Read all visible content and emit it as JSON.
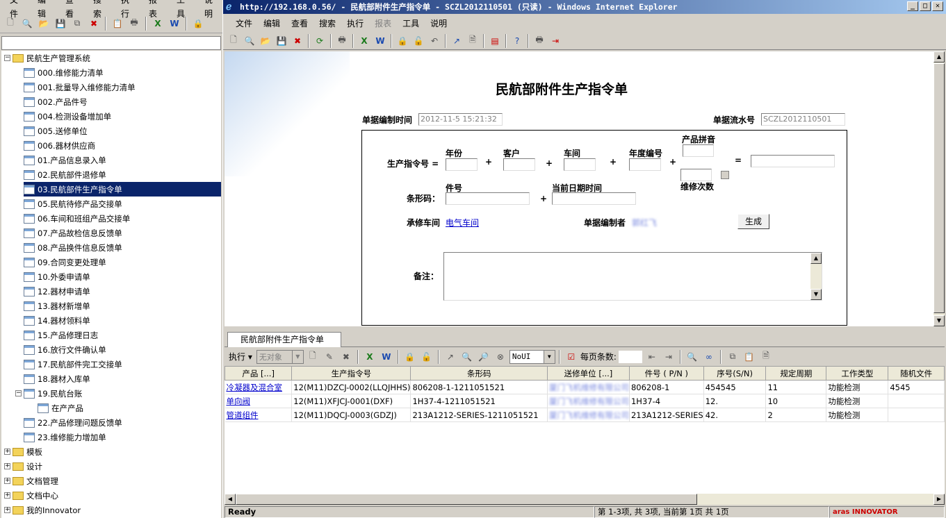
{
  "left_app": {
    "menu": [
      "文件",
      "编辑",
      "查看",
      "搜索",
      "执行",
      "报表",
      "工具",
      "说明"
    ],
    "tree": {
      "root": "民航生产管理系统",
      "items": [
        "000.维修能力清单",
        "001.批量导入维修能力清单",
        "002.产品件号",
        "004.检测设备增加单",
        "005.送修单位",
        "006.器材供应商",
        "01.产品信息录入单",
        "02.民航部件退修单",
        "03.民航部件生产指令单",
        "05.民航待修产品交接单",
        "06.车间和班组产品交接单",
        "07.产品故检信息反馈单",
        "08.产品换件信息反馈单",
        "09.合同变更处理单",
        "10.外委申请单",
        "12.器材申请单",
        "13.器材新增单",
        "14.器材领料单",
        "15.产品修理日志",
        "16.放行文件确认单",
        "17.民航部件完工交接单",
        "18.器材入库单",
        "19.民航台账",
        "在产产品",
        "22.产品修理问题反馈单",
        "23.维修能力增加单"
      ],
      "selected_index": 8,
      "other_roots": [
        "模板",
        "设计",
        "文档管理",
        "文档中心",
        "我的Innovator"
      ]
    }
  },
  "ie": {
    "title": "http://192.168.0.56/ - 民航部附件生产指令单 - SCZL2012110501 (只读) - Windows Internet Explorer",
    "menu": [
      "文件",
      "编辑",
      "查看",
      "搜索",
      "执行",
      "报表",
      "工具",
      "说明"
    ],
    "form": {
      "heading": "民航部附件生产指令单",
      "created_time_label": "单据编制时间",
      "created_time_value": "2012-11-5 15:21:32",
      "serial_label": "单据流水号",
      "serial_value": "SCZL2012110501",
      "order_no_label": "生产指令号 =",
      "year_label": "年份",
      "customer_label": "客户",
      "workshop_label": "车间",
      "annual_no_label": "年度编号",
      "product_pinyin_label": "产品拼音",
      "repair_count_label": "维修次数",
      "plus": "+",
      "equals": "=",
      "barcode_label": "条形码：",
      "part_no_label": "件号",
      "current_date_label": "当前日期时间",
      "repair_workshop_label": "承修车间",
      "repair_workshop_value": "电气车间",
      "author_label": "单据编制者",
      "author_value": "郭红飞",
      "generate_button": "生成",
      "remarks_label": "备注："
    },
    "tab_label": "民航部附件生产指令单",
    "grid_toolbar": {
      "execute_label": "执行 ▾",
      "object_combo": "无对象",
      "view_combo": "NoUI",
      "per_page_label": "每页条数:"
    },
    "grid": {
      "columns": [
        "产品 [...]",
        "生产指令号",
        "条形码",
        "送修单位 [...]",
        "件号 ( P/N )",
        "序号(S/N)",
        "规定周期",
        "工作类型",
        "随机文件"
      ],
      "rows": [
        [
          "冷凝器及混合室",
          "12(M11)DZCJ-0002(LLQJHHS)",
          "806208-1-1211051521",
          "厦门飞机维修有限公司",
          "806208-1",
          "454545",
          "11",
          "功能检测",
          "4545"
        ],
        [
          "单向阀",
          "12(M11)XFJCJ-0001(DXF)",
          "1H37-4-1211051521",
          "厦门飞机维修有限公司",
          "1H37-4",
          "12.",
          "10",
          "功能检测",
          ""
        ],
        [
          "管道组件",
          "12(M11)DQCJ-0003(GDZJ)",
          "213A1212-SERIES-1211051521",
          "厦门飞机维修有限公司",
          "213A1212-SERIES",
          "42.",
          "2",
          "功能检测",
          ""
        ]
      ]
    },
    "status": {
      "ready": "Ready",
      "paging": "第 1-3项, 共 3项, 当前第 1页 共 1页",
      "brand": "aras INNOVATOR"
    }
  }
}
